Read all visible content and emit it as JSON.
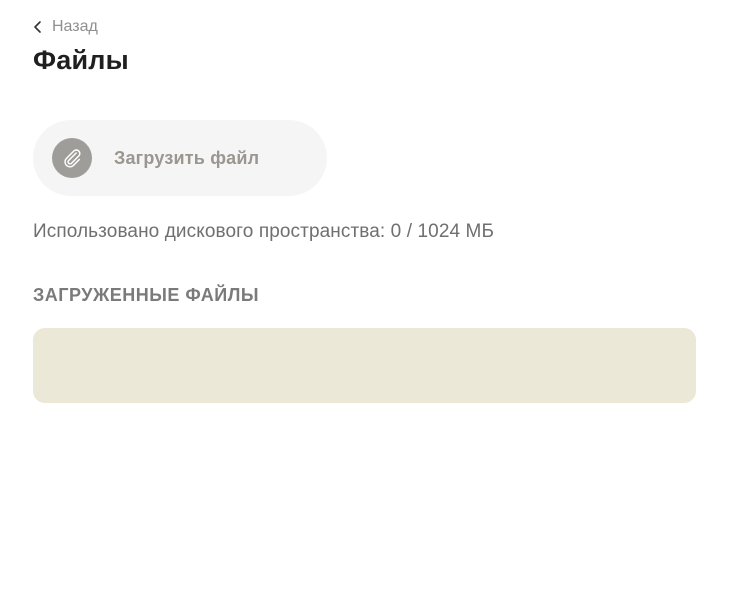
{
  "nav": {
    "back_label": "Назад",
    "back_icon": "chevron-left-icon"
  },
  "page": {
    "title": "Файлы"
  },
  "upload": {
    "label": "Загрузить файл",
    "icon": "paperclip-icon"
  },
  "storage": {
    "usage_text": "Использовано дискового пространства: 0 / 1024 МБ",
    "used_mb": 0,
    "total_mb": 1024
  },
  "files": {
    "heading": "ЗАГРУЖЕННЫЕ ФАЙЛЫ",
    "items": []
  },
  "colors": {
    "panel_bg": "#ebe8d8",
    "icon_circle": "#9f9d99",
    "button_bg": "#f5f5f5"
  }
}
